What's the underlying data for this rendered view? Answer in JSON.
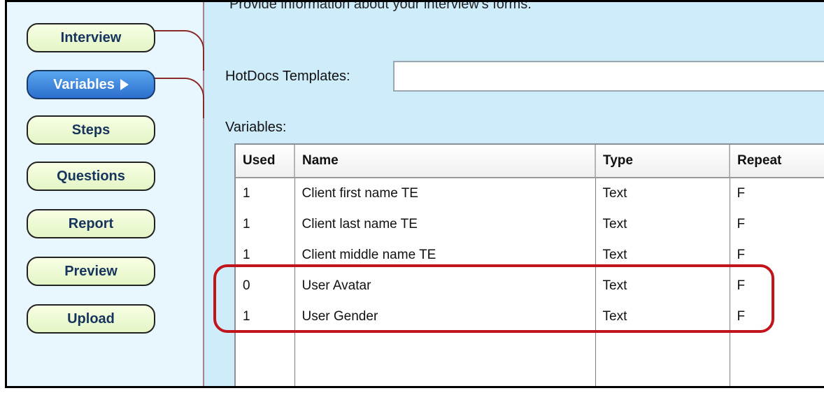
{
  "nav": {
    "items": [
      {
        "label": "Interview",
        "active": false
      },
      {
        "label": "Variables",
        "active": true
      },
      {
        "label": "Steps",
        "active": false
      },
      {
        "label": "Questions",
        "active": false
      },
      {
        "label": "Report",
        "active": false
      },
      {
        "label": "Preview",
        "active": false
      },
      {
        "label": "Upload",
        "active": false
      }
    ]
  },
  "main": {
    "intro_text": "Provide information about your interview's forms.",
    "templates_label": "HotDocs Templates:",
    "templates_value": "",
    "variables_label": "Variables:"
  },
  "table": {
    "columns": [
      "Used",
      "Name",
      "Type",
      "Repeat"
    ],
    "rows": [
      {
        "used": "1",
        "name": "Client first name TE",
        "type": "Text",
        "repeat": "F"
      },
      {
        "used": "1",
        "name": "Client last name TE",
        "type": "Text",
        "repeat": "F"
      },
      {
        "used": "1",
        "name": "Client middle name TE",
        "type": "Text",
        "repeat": "F"
      },
      {
        "used": "0",
        "name": "User Avatar",
        "type": "Text",
        "repeat": "F"
      },
      {
        "used": "1",
        "name": "User Gender",
        "type": "Text",
        "repeat": "F"
      }
    ]
  },
  "colors": {
    "highlight": "#c2141b",
    "active_button": "#2c6fce",
    "panel_background": "#cfecfb"
  }
}
